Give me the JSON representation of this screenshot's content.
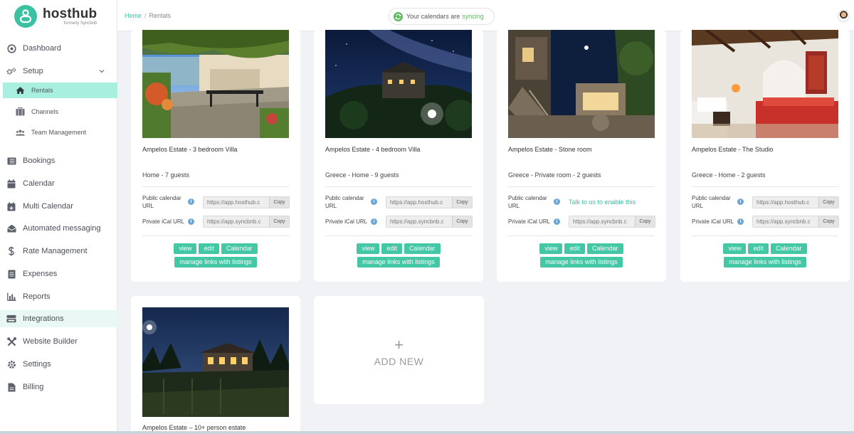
{
  "app": {
    "name": "hosthub",
    "subtitle": "formerly Syncbnb"
  },
  "breadcrumb": {
    "home": "Home",
    "current": "Rentals"
  },
  "sync": {
    "text": "Your calendars are",
    "status": "syncing"
  },
  "sidebar": {
    "items": [
      {
        "label": "Dashboard",
        "icon": "dashboard-icon"
      },
      {
        "label": "Setup",
        "icon": "gears-icon"
      },
      {
        "label": "Rentals",
        "icon": "home-icon"
      },
      {
        "label": "Channels",
        "icon": "channels-icon"
      },
      {
        "label": "Team Management",
        "icon": "team-icon"
      },
      {
        "label": "Bookings",
        "icon": "list-icon"
      },
      {
        "label": "Calendar",
        "icon": "calendar-icon"
      },
      {
        "label": "Multi Calendar",
        "icon": "calendar-plus-icon"
      },
      {
        "label": "Automated messaging",
        "icon": "envelope-icon"
      },
      {
        "label": "Rate Management",
        "icon": "dollar-icon"
      },
      {
        "label": "Expenses",
        "icon": "document-icon"
      },
      {
        "label": "Reports",
        "icon": "bar-chart-icon"
      },
      {
        "label": "Integrations",
        "icon": "integrations-icon"
      },
      {
        "label": "Website Builder",
        "icon": "tools-icon"
      },
      {
        "label": "Settings",
        "icon": "gear-icon"
      },
      {
        "label": "Billing",
        "icon": "billing-icon"
      }
    ]
  },
  "labels": {
    "public_url": "Public calendar URL",
    "private_url": "Private iCal URL",
    "copy": "Copy",
    "view": "view",
    "edit": "edit",
    "calendar": "Calendar",
    "manage": "manage links with listings",
    "talk": "Talk to us to enable this"
  },
  "rentals": [
    {
      "title": "Ampelos Estate - 3 bedroom Villa",
      "subtitle": "Home - 7 guests",
      "public_url": "https://app.hosthub.c",
      "private_url": "https://app.syncbnb.c"
    },
    {
      "title": "Ampelos Estate - 4 bedroom Villa",
      "subtitle": "Greece - Home - 9 guests",
      "public_url": "https://app.hosthub.c",
      "private_url": "https://app.syncbnb.c"
    },
    {
      "title": "Ampelos Estate - Stone room",
      "subtitle": "Greece - Private room - 2 guests",
      "public_url": "",
      "private_url": "https://app.syncbnb.c"
    },
    {
      "title": "Ampelos Estate - The Studio",
      "subtitle": "Greece - Home - 2 guests",
      "public_url": "https://app.hosthub.c",
      "private_url": "https://app.syncbnb.c"
    },
    {
      "title": "Ampelos Estate – 10+ person estate"
    }
  ],
  "add_new": {
    "plus": "+",
    "label": "ADD NEW"
  },
  "colors": {
    "accent": "#3bc1a0",
    "button": "#43c7a4",
    "active_bg": "#a9efe0",
    "sync_green": "#5cb85c"
  }
}
